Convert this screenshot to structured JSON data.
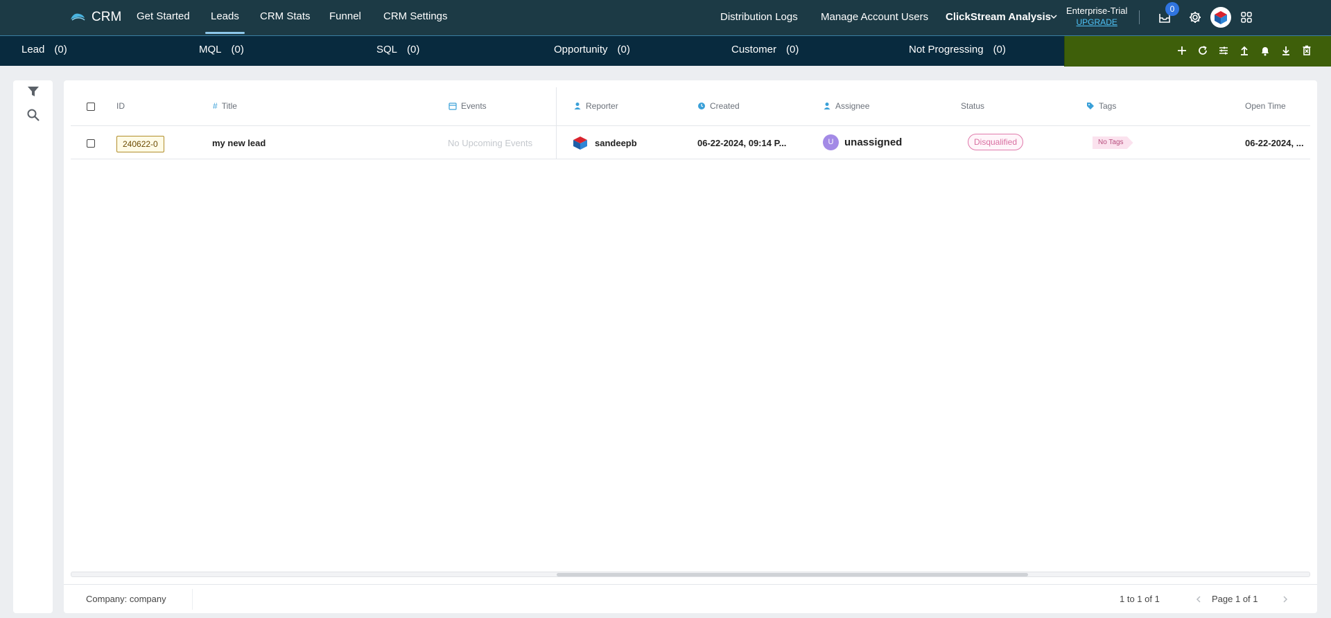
{
  "app": {
    "logo_text": "CRM",
    "nav": [
      "Get Started",
      "Leads",
      "CRM Stats",
      "Funnel",
      "CRM Settings"
    ],
    "nav_active": "Leads",
    "right_links": {
      "distribution_logs": "Distribution Logs",
      "manage_users": "Manage Account Users",
      "workspace": "ClickStream Analysis"
    },
    "plan": {
      "name": "Enterprise-Trial",
      "upgrade": "UPGRADE"
    },
    "inbox_badge": "0",
    "accent": "#1c3a45"
  },
  "stages": [
    {
      "label": "Lead",
      "count": "(0)"
    },
    {
      "label": "MQL",
      "count": "(0)"
    },
    {
      "label": "SQL",
      "count": "(0)"
    },
    {
      "label": "Opportunity",
      "count": "(0)"
    },
    {
      "label": "Customer",
      "count": "(0)"
    },
    {
      "label": "Not Progressing",
      "count": "(0)"
    }
  ],
  "table": {
    "headers": {
      "id": "ID",
      "title": "Title",
      "events": "Events",
      "reporter": "Reporter",
      "created": "Created",
      "assignee": "Assignee",
      "status": "Status",
      "tags": "Tags",
      "open_time": "Open Time"
    },
    "rows": [
      {
        "id": "240622-0",
        "title": "my new lead",
        "events": "No Upcoming Events",
        "reporter": "sandeepb",
        "created": "06-22-2024, 09:14 P...",
        "assignee_initial": "U",
        "assignee": "unassigned",
        "status": "Disqualified",
        "tags": "No Tags",
        "open_time": "06-22-2024, ..."
      }
    ]
  },
  "footer": {
    "company": "Company: company",
    "range": "1 to 1 of 1",
    "page": "Page 1 of 1"
  }
}
